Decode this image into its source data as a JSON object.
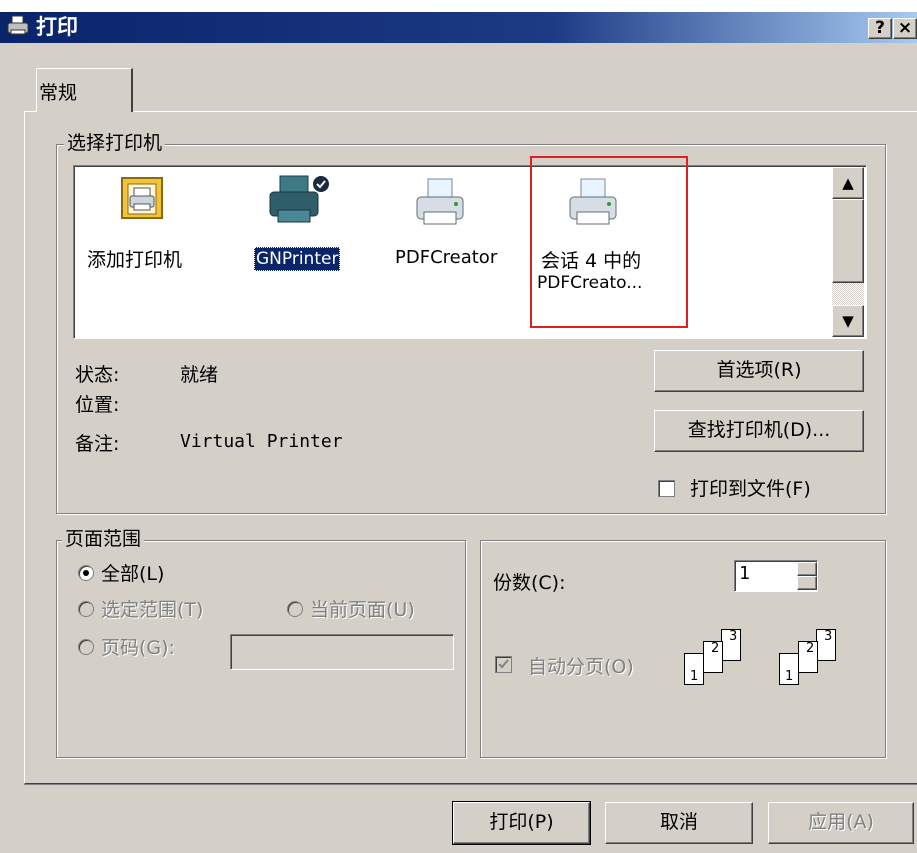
{
  "dialog": {
    "title": "打印",
    "help_label": "?",
    "close_label": "×"
  },
  "tabs": [
    {
      "label": "常规"
    }
  ],
  "printer_group": {
    "legend": "选择打印机",
    "printers": [
      {
        "label": "添加打印机",
        "icon": "add-printer-icon"
      },
      {
        "label": "GNPrinter",
        "icon": "printer-icon",
        "selected": true
      },
      {
        "label": "PDFCreator",
        "icon": "printer-icon"
      },
      {
        "label": "会话 4 中的",
        "label2": "PDFCreato...",
        "icon": "printer-icon",
        "highlighted": true
      }
    ],
    "scroll_up": "▲",
    "scroll_down": "▼",
    "status_label": "状态:",
    "status_value": "就绪",
    "location_label": "位置:",
    "location_value": "",
    "comment_label": "备注:",
    "comment_value": "Virtual Printer",
    "preferences_button": "首选项(R)",
    "find_printer_button": "查找打印机(D)...",
    "print_to_file_label": "打印到文件(F)"
  },
  "page_range": {
    "legend": "页面范围",
    "all_label": "全部(L)",
    "selection_label": "选定范围(T)",
    "current_page_label": "当前页面(U)",
    "pages_label": "页码(G):",
    "pages_value": ""
  },
  "copies": {
    "label": "份数(C):",
    "value": "1",
    "collate_label": "自动分页(O)",
    "collate_pages": [
      "1",
      "2",
      "3"
    ]
  },
  "buttons": {
    "print": "打印(P)",
    "cancel": "取消",
    "apply": "应用(A)"
  },
  "colors": {
    "title_bar": "#0a246a",
    "face": "#d4d0c8",
    "selection": "#0a246a",
    "annotation_box": "#e02020"
  }
}
